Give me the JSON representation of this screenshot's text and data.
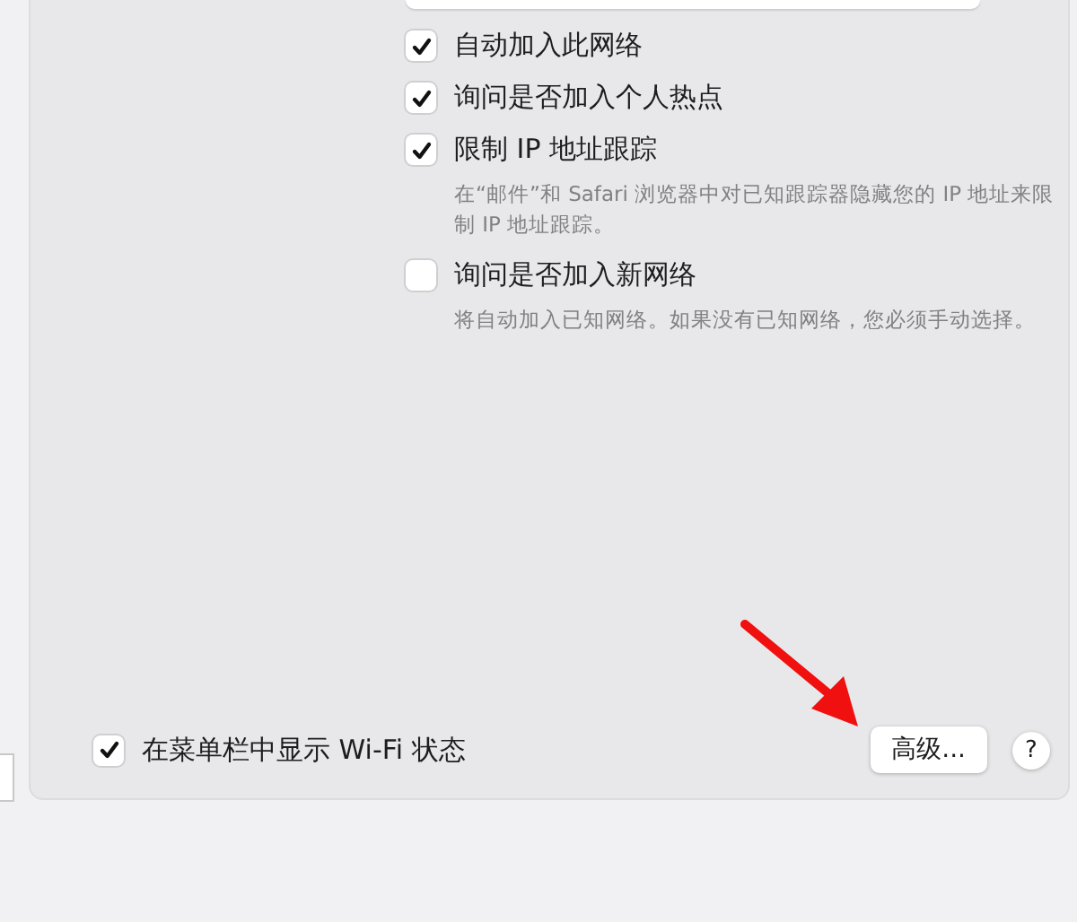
{
  "options": [
    {
      "label": "自动加入此网络",
      "checked": true
    },
    {
      "label": "询问是否加入个人热点",
      "checked": true
    },
    {
      "label": "限制 IP 地址跟踪",
      "checked": true,
      "description": "在“邮件”和 Safari 浏览器中对已知跟踪器隐藏您的 IP 地址来限制 IP 地址跟踪。"
    },
    {
      "label": "询问是否加入新网络",
      "checked": false,
      "description": "将自动加入已知网络。如果没有已知网络，您必须手动选择。"
    }
  ],
  "menu_bar_option": {
    "label": "在菜单栏中显示 Wi-Fi 状态",
    "checked": true
  },
  "buttons": {
    "advanced": "高级...",
    "help": "?"
  }
}
